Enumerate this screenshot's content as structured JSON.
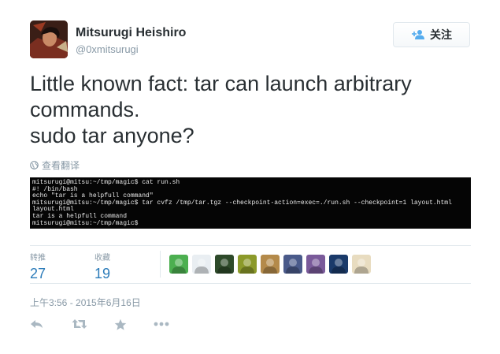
{
  "user": {
    "fullname": "Mitsurugi Heishiro",
    "username": "@0xmitsurugi",
    "avatar_icon": "user-avatar"
  },
  "follow_button": {
    "label": "关注",
    "icon": "follow-user-icon"
  },
  "tweet": {
    "lines": [
      "Little known fact: tar can launch arbitrary",
      "commands.",
      "sudo tar anyone?"
    ]
  },
  "translate": {
    "label": "查看翻译",
    "icon": "globe-icon"
  },
  "terminal": {
    "lines": [
      "mitsurugi@mitsu:~/tmp/magic$ cat run.sh",
      "#! /bin/bash",
      "echo \"tar is a helpfull command\"",
      "mitsurugi@mitsu:~/tmp/magic$ tar cvfz /tmp/tar.tgz --checkpoint-action=exec=./run.sh --checkpoint=1 layout.html",
      "layout.html",
      "tar is a helpfull command",
      "mitsurugi@mitsu:~/tmp/magic$"
    ]
  },
  "stats": {
    "retweets": {
      "label": "转推",
      "value": "27"
    },
    "favorites": {
      "label": "收藏",
      "value": "19"
    }
  },
  "favoriters": [
    {
      "name": "favoriter-avatar-1",
      "color": "#4caf50"
    },
    {
      "name": "favoriter-avatar-2",
      "color": "#e9eef2"
    },
    {
      "name": "favoriter-avatar-3",
      "color": "#2e4a2a"
    },
    {
      "name": "favoriter-avatar-4",
      "color": "#8c9a2a"
    },
    {
      "name": "favoriter-avatar-5",
      "color": "#b48a4a"
    },
    {
      "name": "favoriter-avatar-6",
      "color": "#4a5a8a"
    },
    {
      "name": "favoriter-avatar-7",
      "color": "#7a5a9a"
    },
    {
      "name": "favoriter-avatar-8",
      "color": "#1a3a6a"
    },
    {
      "name": "favoriter-avatar-9",
      "color": "#e8dcc0"
    }
  ],
  "timestamp": "上午3:56 - 2015年6月16日",
  "actions": {
    "reply_icon": "reply-icon",
    "retweet_icon": "retweet-icon",
    "favorite_icon": "star-icon",
    "more_icon": "more-dots-icon"
  },
  "colors": {
    "link": "#2b7bb9",
    "muted": "#8899a6",
    "text": "#292f33",
    "divider": "#e1e8ed",
    "action_icon": "#aab8c2",
    "terminal_bg": "#050505"
  }
}
